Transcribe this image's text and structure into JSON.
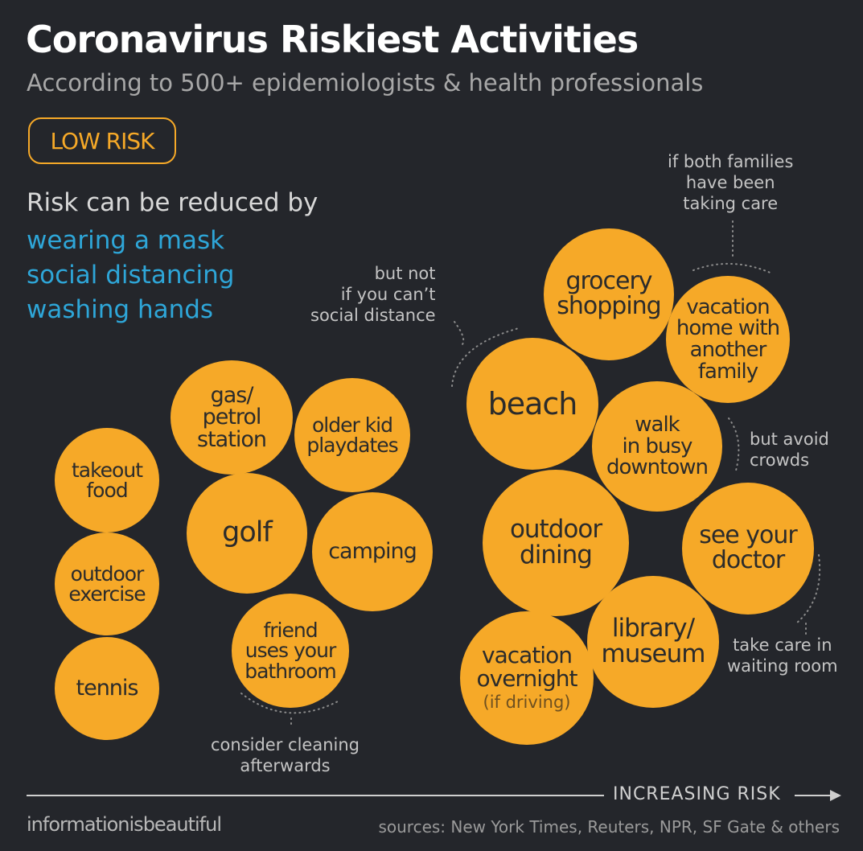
{
  "title": "Coronavirus Riskiest Activities",
  "subtitle": "According to 500+ epidemiologists & health professionals",
  "risk_level": "LOW RISK",
  "reduce_heading": "Risk can be reduced by",
  "tips": [
    "wearing a mask",
    "social distancing",
    "washing hands"
  ],
  "activities": [
    {
      "lines": [
        "takeout",
        "food"
      ]
    },
    {
      "lines": [
        "outdoor",
        "exercise"
      ]
    },
    {
      "lines": [
        "tennis"
      ]
    },
    {
      "lines": [
        "gas/",
        "petrol",
        "station"
      ]
    },
    {
      "lines": [
        "older kid",
        "playdates"
      ]
    },
    {
      "lines": [
        "golf"
      ]
    },
    {
      "lines": [
        "camping"
      ]
    },
    {
      "lines": [
        "friend",
        "uses your",
        "bathroom"
      ]
    },
    {
      "lines": [
        "beach"
      ]
    },
    {
      "lines": [
        "grocery",
        "shopping"
      ]
    },
    {
      "lines": [
        "vacation",
        "home with",
        "another",
        "family"
      ]
    },
    {
      "lines": [
        "walk",
        "in busy",
        "downtown"
      ]
    },
    {
      "lines": [
        "outdoor",
        "dining"
      ]
    },
    {
      "lines": [
        "see your",
        "doctor"
      ]
    },
    {
      "lines": [
        "library/",
        "museum"
      ]
    },
    {
      "lines": [
        "vacation",
        "overnight"
      ],
      "sub": "(if driving)"
    }
  ],
  "notes": {
    "families": [
      "if both families",
      "have been",
      "taking care"
    ],
    "beach": [
      "but not",
      "if you can’t",
      "social distance"
    ],
    "downtown": [
      "but avoid",
      "crowds"
    ],
    "doctor": [
      "take care in",
      "waiting room"
    ],
    "bathroom": [
      "consider cleaning",
      "afterwards"
    ]
  },
  "axis_label": "INCREASING RISK",
  "brand": "informationisbeautiful",
  "sources": "sources: New York Times, Reuters, NPR, SF Gate & others",
  "colors": {
    "background": "#24262b",
    "bubble": "#f6a928",
    "accent_blue": "#2ea6d8",
    "subtitle_gray": "#a8a8a8"
  }
}
